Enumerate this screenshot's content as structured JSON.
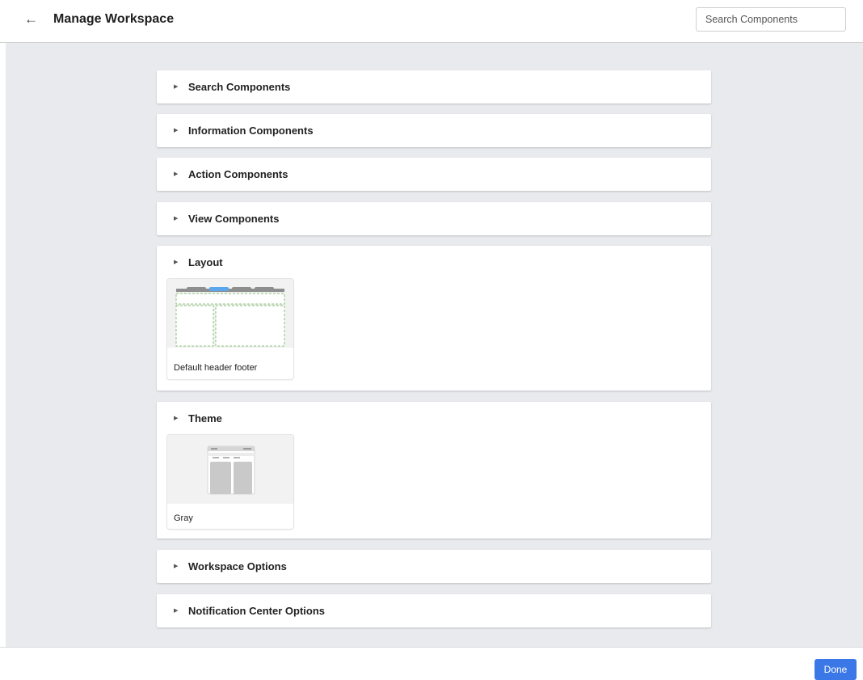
{
  "header": {
    "title": "Manage Workspace",
    "back_icon": "arrow-left-icon",
    "search": {
      "placeholder": "Search Components",
      "value": ""
    }
  },
  "sections": [
    {
      "label": "Search Components",
      "expanded": false
    },
    {
      "label": "Information Components",
      "expanded": false
    },
    {
      "label": "Action Components",
      "expanded": false
    },
    {
      "label": "View Components",
      "expanded": false
    },
    {
      "label": "Layout",
      "expanded": true,
      "cards": [
        {
          "label": "Default header footer",
          "thumbnail": "layout-preview"
        }
      ]
    },
    {
      "label": "Theme",
      "expanded": true,
      "cards": [
        {
          "label": "Gray",
          "thumbnail": "theme-preview"
        }
      ]
    },
    {
      "label": "Workspace Options",
      "expanded": false
    },
    {
      "label": "Notification Center Options",
      "expanded": false
    }
  ],
  "footer": {
    "done_label": "Done"
  },
  "colors": {
    "accent": "#3b78e7",
    "content_background": "#e9eaee",
    "layout_outline": "#8bc37a",
    "selected_tab": "#5aa7ee"
  }
}
